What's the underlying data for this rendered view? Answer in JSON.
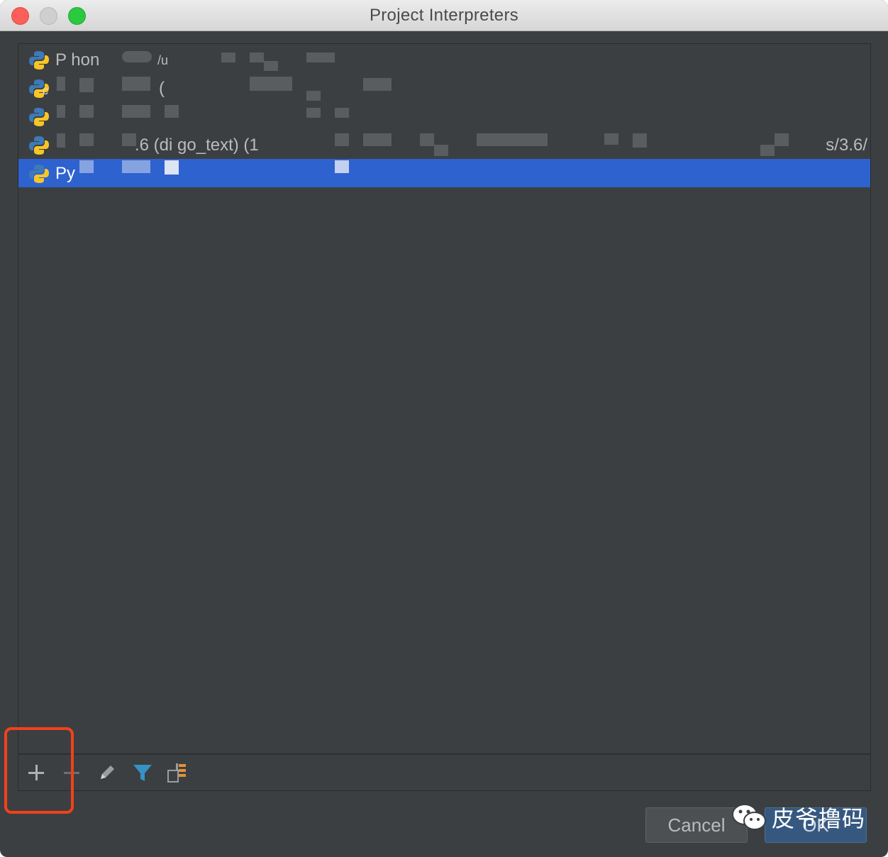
{
  "window": {
    "title": "Project Interpreters"
  },
  "interpreters": [
    {
      "label": "P  hon",
      "suffix": "/u",
      "path": ""
    },
    {
      "label": "(",
      "suffix": "",
      "path": ""
    },
    {
      "label": "",
      "suffix": "",
      "path": ""
    },
    {
      "label": ".6 (di  go_text) (1",
      "suffix": "",
      "path": "s/3.6/"
    },
    {
      "label": "Py",
      "suffix": "",
      "path": "",
      "selected": true
    }
  ],
  "toolbar": {
    "add_icon": "plus-icon",
    "remove_icon": "minus-icon",
    "edit_icon": "pencil-icon",
    "filter_icon": "filter-icon",
    "paths_icon": "tree-paths-icon"
  },
  "buttons": {
    "cancel_label": "Cancel",
    "ok_label": "OK"
  },
  "watermark": {
    "text": "皮爷撸码"
  },
  "colors": {
    "selection": "#2e62cf",
    "highlight": "#f0421a",
    "background": "#3c3f41"
  }
}
